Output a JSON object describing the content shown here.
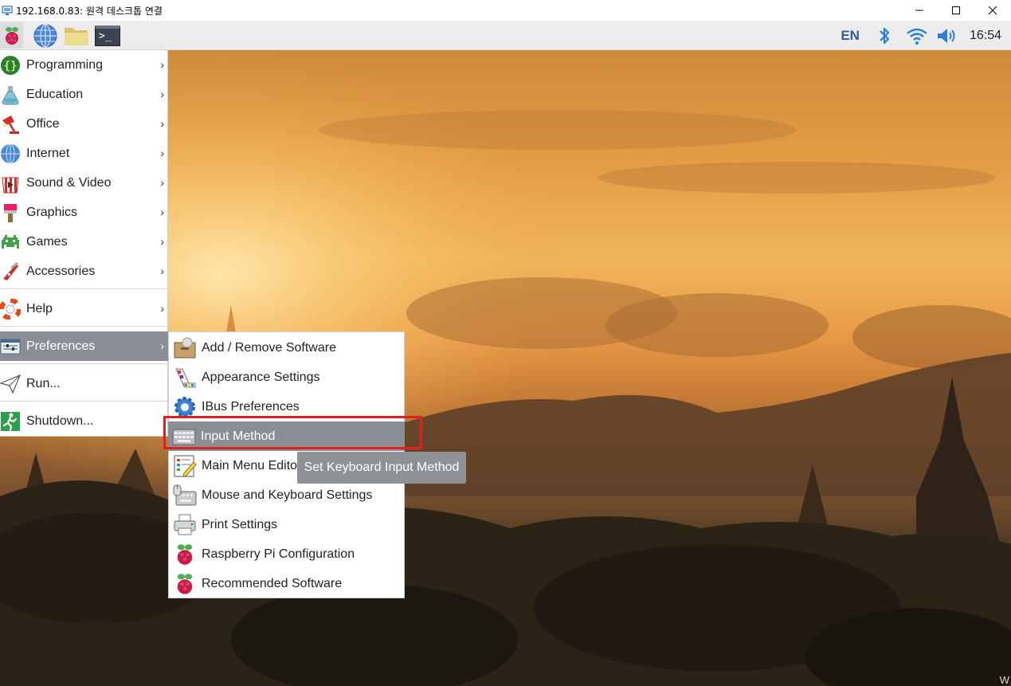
{
  "window": {
    "title": "192.168.0.83: 원격 데스크톱 연결",
    "controls": [
      "minimize",
      "maximize",
      "close"
    ]
  },
  "taskbar": {
    "launchers": [
      {
        "name": "raspberry-menu",
        "icon": "raspberry-icon"
      },
      {
        "name": "web-browser",
        "icon": "globe-icon"
      },
      {
        "name": "file-manager",
        "icon": "folder-icon"
      },
      {
        "name": "terminal",
        "icon": "terminal-icon"
      }
    ],
    "terminal_glyph": ">_",
    "language": "EN",
    "clock": "16:54",
    "tray_icons": [
      "bluetooth-icon",
      "wifi-icon",
      "volume-icon"
    ]
  },
  "menu": {
    "items": [
      {
        "label": "Programming",
        "icon": "braces-icon",
        "has_submenu": true
      },
      {
        "label": "Education",
        "icon": "flask-icon",
        "has_submenu": true
      },
      {
        "label": "Office",
        "icon": "lamp-icon",
        "has_submenu": true
      },
      {
        "label": "Internet",
        "icon": "globe-icon",
        "has_submenu": true
      },
      {
        "label": "Sound & Video",
        "icon": "popcorn-icon",
        "has_submenu": true
      },
      {
        "label": "Graphics",
        "icon": "paintbrush-icon",
        "has_submenu": true
      },
      {
        "label": "Games",
        "icon": "invader-icon",
        "has_submenu": true
      },
      {
        "label": "Accessories",
        "icon": "knife-icon",
        "has_submenu": true
      },
      {
        "label": "Help",
        "icon": "lifebuoy-icon",
        "has_submenu": true
      },
      {
        "label": "Preferences",
        "icon": "sliders-icon",
        "has_submenu": true,
        "active": true
      },
      {
        "label": "Run...",
        "icon": "paperplane-icon",
        "has_submenu": false
      },
      {
        "label": "Shutdown...",
        "icon": "exit-icon",
        "has_submenu": false
      }
    ],
    "arrow_glyph": "›"
  },
  "submenu": {
    "items": [
      {
        "label": "Add / Remove Software",
        "icon": "package-icon"
      },
      {
        "label": "Appearance Settings",
        "icon": "palette-icon"
      },
      {
        "label": "IBus Preferences",
        "icon": "gear-icon"
      },
      {
        "label": "Input Method",
        "icon": "keyboard-icon",
        "active": true
      },
      {
        "label": "Main Menu Editor",
        "icon": "menu-editor-icon"
      },
      {
        "label": "Mouse and Keyboard Settings",
        "icon": "mouse-keyboard-icon"
      },
      {
        "label": "Print Settings",
        "icon": "printer-icon"
      },
      {
        "label": "Raspberry Pi Configuration",
        "icon": "raspberry-icon"
      },
      {
        "label": "Recommended Software",
        "icon": "raspberry-icon"
      }
    ]
  },
  "tooltip": {
    "text": "Set Keyboard Input Method"
  },
  "colors": {
    "highlight": "#8a8f95",
    "annotation_box": "#e0201a",
    "tray_blue": "#2a7fd4",
    "lang_blue": "#2f5b9c"
  }
}
